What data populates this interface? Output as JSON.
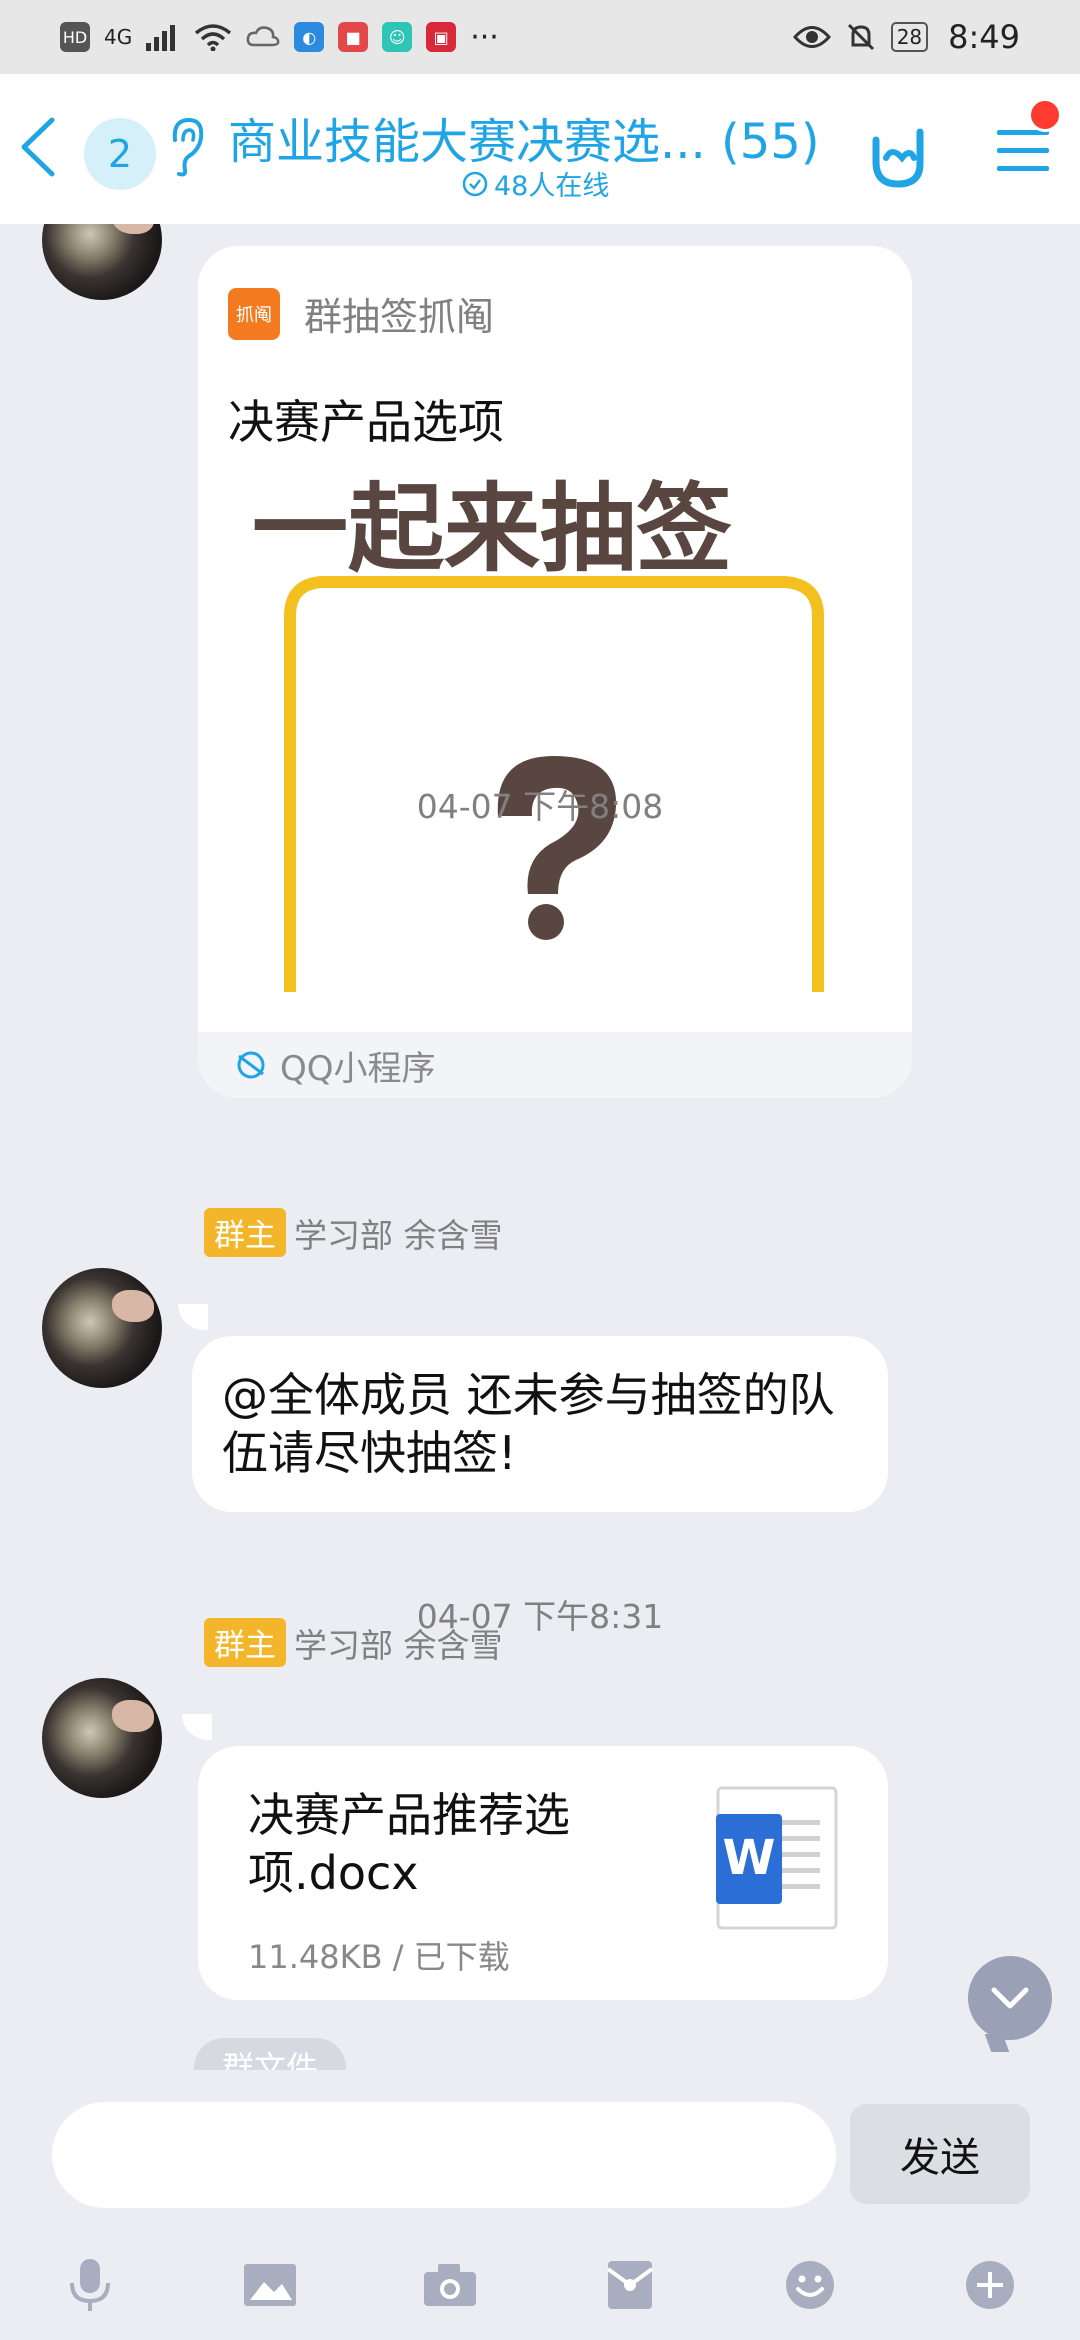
{
  "status_bar": {
    "hd": "HD",
    "network": "4G",
    "more": "···",
    "battery": "28",
    "time": "8:49"
  },
  "header": {
    "unread_count": "2",
    "title": "商业技能大赛决赛选... (55)",
    "online": "48人在线"
  },
  "messages": {
    "card": {
      "app_icon_text": "抓阄",
      "app_name": "群抽签抓阄",
      "title": "决赛产品选项",
      "image_text": "一起来抽签",
      "footer": "QQ小程序"
    },
    "time1": "04-07 下午8:08",
    "msg1": {
      "role": "群主",
      "sender": "学习部 余含雪",
      "text": "@全体成员 还未参与抽签的队伍请尽快抽签!"
    },
    "time2": "04-07 下午8:31",
    "msg2": {
      "role": "群主",
      "sender": "学习部 余含雪",
      "file_name": "决赛产品推荐选项.docx",
      "file_meta": "11.48KB / 已下载"
    },
    "group_file_chip": "群文件"
  },
  "input": {
    "placeholder": "",
    "send_label": "发送"
  },
  "colors": {
    "accent": "#1fa4e6",
    "badge": "#f3b62a",
    "background": "#ebedf3"
  }
}
